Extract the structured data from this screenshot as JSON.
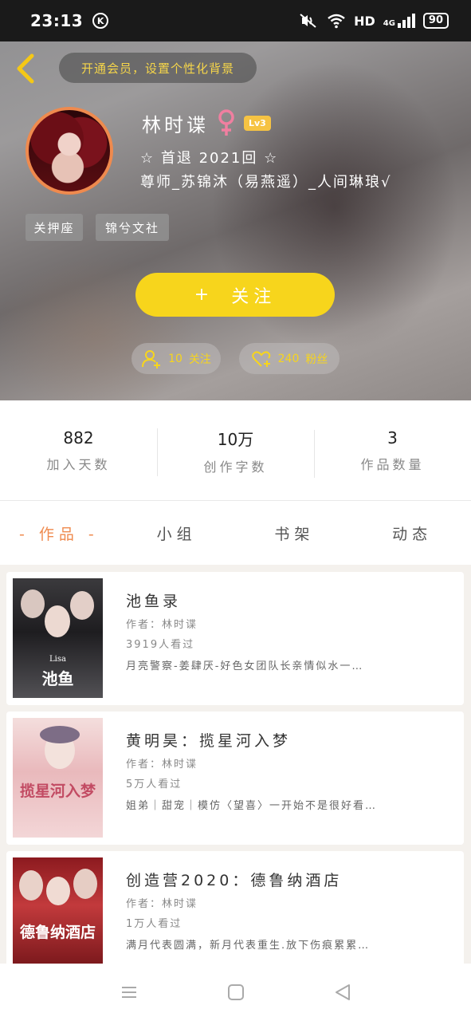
{
  "status_bar": {
    "time": "23:13",
    "k_icon": "K",
    "network": "HD",
    "signal_label": "4G",
    "battery": "90",
    "icons": [
      "mute-vibrate-icon",
      "wifi-icon",
      "signal-icon",
      "battery-icon"
    ]
  },
  "header": {
    "back_icon": "chevron-left-icon",
    "vip_banner": "开通会员，设置个性化背景"
  },
  "profile": {
    "name": "林时谍",
    "gender_icon": "female-symbol-icon",
    "level": "Lv3",
    "bio_line1": "☆ 首退 2021回 ☆",
    "bio_line2": "尊师_苏锦沐（易燕遥）_人间琳琅√",
    "tags": [
      "关押座",
      "锦兮文社"
    ],
    "follow_button": {
      "icon": "+",
      "label": "关注"
    },
    "following": {
      "count": "10",
      "label": "关注"
    },
    "fans": {
      "count": "240",
      "label": "粉丝"
    }
  },
  "stats": [
    {
      "value": "882",
      "label": "加入天数"
    },
    {
      "value": "10万",
      "label": "创作字数"
    },
    {
      "value": "3",
      "label": "作品数量"
    }
  ],
  "tabs": [
    {
      "label": "- 作品 -",
      "active": true
    },
    {
      "label": "小组",
      "active": false
    },
    {
      "label": "书架",
      "active": false
    },
    {
      "label": "动态",
      "active": false
    }
  ],
  "works": [
    {
      "title": "池鱼录",
      "author": "作者：林时谍",
      "reads": "3919人看过",
      "desc": "月亮警察-姜肆厌-好色女团队长亲情似水一…",
      "cover_text": "池鱼",
      "cover_subtext": "Lisa"
    },
    {
      "title": "黄明昊：揽星河入梦",
      "author": "作者：林时谍",
      "reads": "5万人看过",
      "desc": "姐弟｜甜宠｜模仿〈望喜〉一开始不是很好看…",
      "cover_text": "揽星河入梦"
    },
    {
      "title": "创造营2020：德鲁纳酒店",
      "author": "作者：林时谍",
      "reads": "1万人看过",
      "desc": "满月代表圆满，新月代表重生.放下伤痕累累…",
      "cover_text": "德鲁纳酒店"
    }
  ],
  "nav": [
    "menu-icon",
    "home-square-icon",
    "back-triangle-icon"
  ]
}
